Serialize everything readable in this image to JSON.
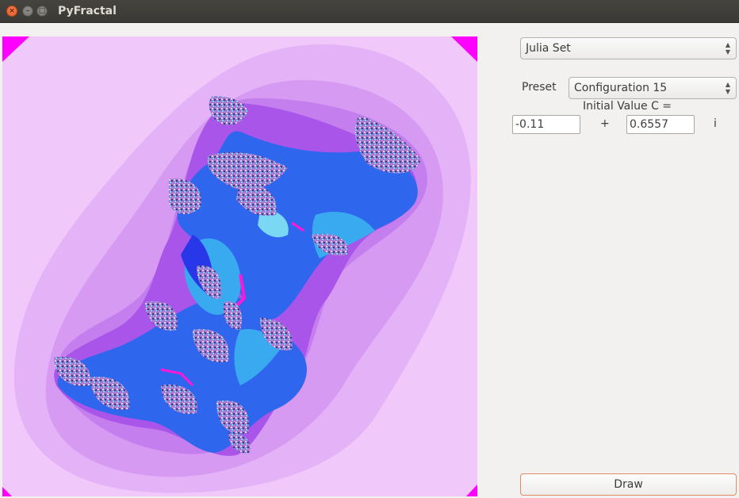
{
  "window": {
    "title": "PyFractal",
    "close_glyph": "×",
    "minimize_glyph": "–",
    "maximize_glyph": "□"
  },
  "colors": {
    "background": "#f0c8fa",
    "corner": "#ff00ff",
    "level1": "#e4b2f6",
    "level2": "#d69af2",
    "level3": "#c57eee",
    "level4": "#aa55ea",
    "deep_blue": "#2838e8",
    "mid_blue": "#2f66ee",
    "cyan": "#3aaaf0",
    "light_cyan": "#7ad8f5",
    "pink": "#f4a0e6",
    "magenta": "#ff18d8",
    "dark": "#3a3a7a"
  },
  "controls": {
    "fractal_type": "Julia Set",
    "preset_label": "Preset",
    "preset_value": "Configuration 15",
    "initial_value_label": "Initial Value C =",
    "real_part": "-0.11",
    "plus_sign": "+",
    "imag_part": "0.6557",
    "imag_unit": "i",
    "draw_button": "Draw"
  },
  "icons": {
    "combo_arrow_up": "▲",
    "combo_arrow_down": "▼"
  }
}
